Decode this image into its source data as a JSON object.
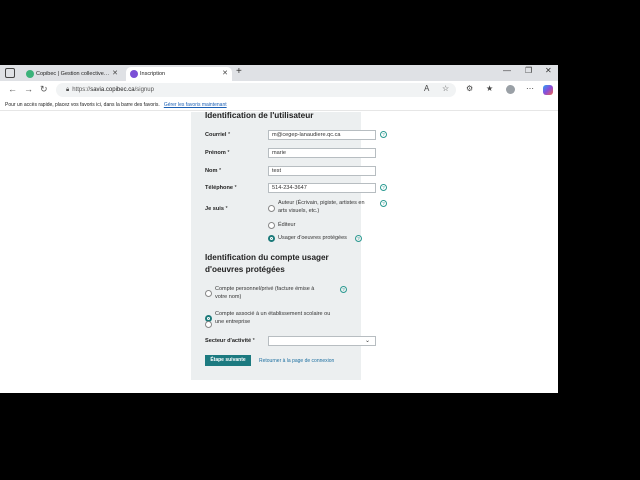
{
  "tabs": [
    {
      "title": "Copibec | Gestion collective des dr..."
    },
    {
      "title": "Inscription"
    }
  ],
  "address": {
    "scheme": "https://",
    "host": "savia.copibec.ca",
    "path": "/signup"
  },
  "favorites_bar": {
    "text": "Pour un accès rapide, placez vos favoris ici, dans la barre des favoris.",
    "link": "Gérer les favoris maintenant"
  },
  "form": {
    "section1_title": "Identification de l'utilisateur",
    "fields": {
      "email": {
        "label": "Courriel",
        "value": "m@cegep-lanaudiere.qc.ca"
      },
      "firstname": {
        "label": "Prénom",
        "value": "marie"
      },
      "lastname": {
        "label": "Nom",
        "value": "test"
      },
      "phone": {
        "label": "Téléphone",
        "value": "514-234-3647"
      }
    },
    "role": {
      "label": "Je suis",
      "options": [
        {
          "text": "Auteur (Écrivain, pigiste, artistes en arts visuels, etc.)",
          "selected": false
        },
        {
          "text": "Éditeur",
          "selected": false
        },
        {
          "text": "Usager d'oeuvres protégées",
          "selected": true
        }
      ]
    },
    "section2_title": "Identification du compte usager d'oeuvres protégées",
    "account": {
      "options": [
        {
          "text": "Compte personnel/privé (facture émise à votre nom)",
          "selected": false
        },
        {
          "text": "Compte associé à un établissement scolaire ou une entreprise",
          "selected": true
        }
      ]
    },
    "sector": {
      "label": "Secteur d'activité",
      "value": ""
    },
    "required_mark": "*",
    "next_button": "Étape suivante",
    "back_link": "Retourner à la page de connexion"
  },
  "colors": {
    "accent": "#1c7a80",
    "panel": "#eceff0"
  }
}
